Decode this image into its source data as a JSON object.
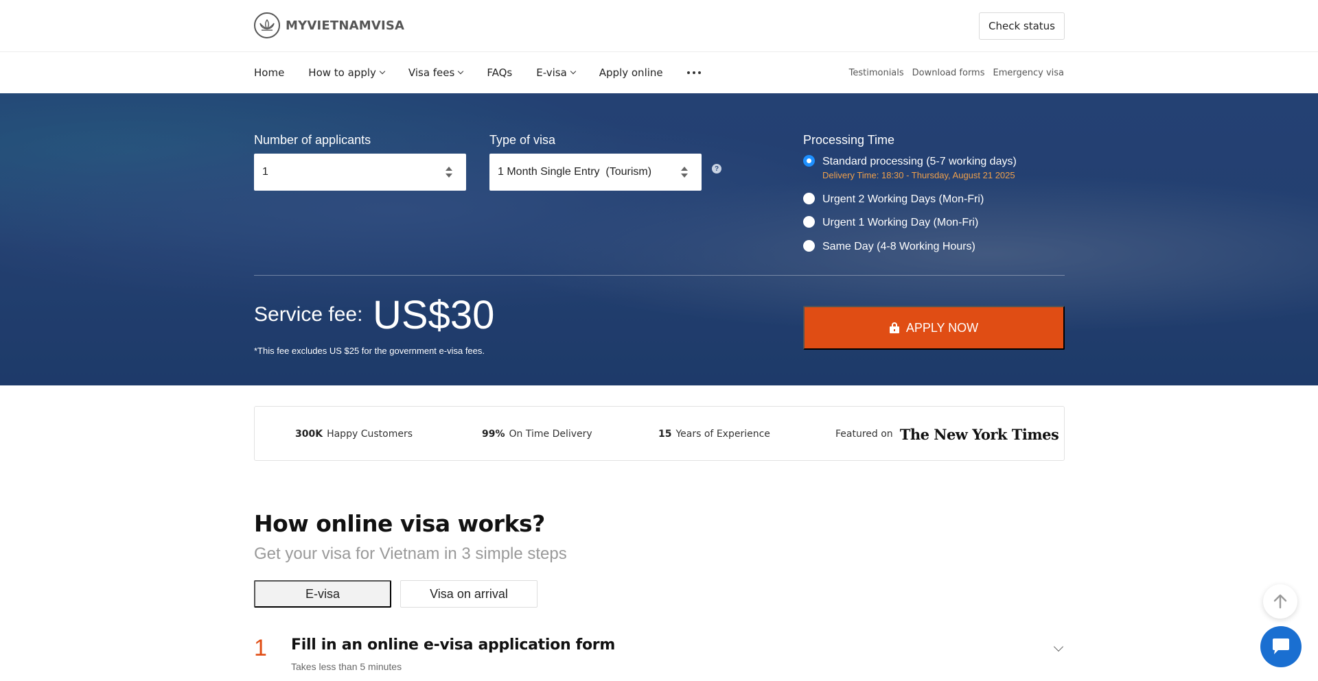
{
  "header": {
    "logo_text": "MYVIETNAMVISA",
    "check_status_label": "Check status"
  },
  "nav": {
    "items": [
      {
        "label": "Home",
        "has_dropdown": false
      },
      {
        "label": "How to apply",
        "has_dropdown": true
      },
      {
        "label": "Visa fees",
        "has_dropdown": true
      },
      {
        "label": "FAQs",
        "has_dropdown": false
      },
      {
        "label": "E-visa",
        "has_dropdown": true
      },
      {
        "label": "Apply online",
        "has_dropdown": false
      }
    ],
    "more_icon": "more-dots-icon",
    "right_links": [
      "Testimonials",
      "Download forms",
      "Emergency visa"
    ]
  },
  "form": {
    "applicants_label": "Number of applicants",
    "applicants_value": "1",
    "visa_type_label": "Type of visa",
    "visa_type_value": "1 Month Single Entry  (Tourism)",
    "help_icon": "question-circle-icon",
    "processing_label": "Processing Time",
    "processing_options": [
      {
        "label": "Standard processing (5-7 working days)",
        "selected": true,
        "note": "Delivery Time: 18:30 - Thursday, August 21 2025"
      },
      {
        "label": "Urgent 2 Working Days (Mon-Fri)",
        "selected": false
      },
      {
        "label": "Urgent 1 Working Day (Mon-Fri)",
        "selected": false
      },
      {
        "label": "Same Day (4-8 Working Hours)",
        "selected": false
      }
    ]
  },
  "fee": {
    "label": "Service fee:",
    "amount": "US$30",
    "note": "*This fee excludes US $25 for the government e-visa fees.",
    "apply_label": "APPLY NOW"
  },
  "stats": {
    "customers_value": "300K",
    "customers_label": "Happy Customers",
    "delivery_value": "99%",
    "delivery_label": "On Time Delivery",
    "years_value": "15",
    "years_label": "Years of Experience",
    "featured_label": "Featured on",
    "featured_brand": "The New York Times"
  },
  "how": {
    "title": "How online visa works?",
    "subtitle": "Get your visa for Vietnam in 3 simple steps",
    "tabs": [
      "E-visa",
      "Visa on arrival"
    ],
    "active_tab": "E-visa",
    "step_number": "1",
    "step_title": "Fill in an online e-visa application form",
    "step_subtitle": "Takes less than 5 minutes"
  },
  "colors": {
    "accent": "#e04d14",
    "hero_bg": "#2b4a7c",
    "radio_selected": "#1e90ff",
    "delivery_note": "#f0a04b",
    "chat_button": "#1a6fd1"
  }
}
